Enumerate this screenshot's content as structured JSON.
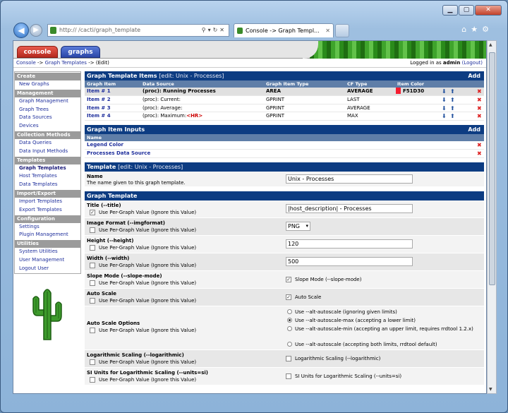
{
  "browser": {
    "url": "http://                    /cacti/graph_template",
    "tab_title": "Console -> Graph Templ...",
    "tab_close": "✕"
  },
  "top_tabs": {
    "console": "console",
    "graphs": "graphs"
  },
  "breadcrumb": {
    "c1": "Console",
    "sep1": "->",
    "c2": "Graph Templates",
    "sep2": "->",
    "c3": "(Edit)"
  },
  "login": {
    "prefix": "Logged in as",
    "user": "admin",
    "logout": "(Logout)"
  },
  "sidebar": {
    "create": "Create",
    "new_graphs": "New Graphs",
    "management": "Management",
    "graph_management": "Graph Management",
    "graph_trees": "Graph Trees",
    "data_sources": "Data Sources",
    "devices": "Devices",
    "collection": "Collection Methods",
    "data_queries": "Data Queries",
    "data_input": "Data Input Methods",
    "templates": "Templates",
    "graph_templates": "Graph Templates",
    "host_templates": "Host Templates",
    "data_templates": "Data Templates",
    "import_export": "Import/Export",
    "import_templates": "Import Templates",
    "export_templates": "Export Templates",
    "configuration": "Configuration",
    "settings": "Settings",
    "plugin_mgmt": "Plugin Management",
    "utilities": "Utilities",
    "system_utilities": "System Utilities",
    "user_management": "User Management",
    "logout_user": "Logout User"
  },
  "items": {
    "title": "Graph Template Items",
    "edit": "[edit: Unix - Processes]",
    "add": "Add",
    "cols": [
      "Graph Item",
      "Data Source",
      "Graph Item Type",
      "CF Type",
      "Item Color"
    ],
    "rows": [
      {
        "item": "Item # 1",
        "ds": "(proc): Running Processes",
        "type": "AREA",
        "cf": "AVERAGE",
        "color": "F51D30"
      },
      {
        "item": "Item # 2",
        "ds": "(proc): Current:",
        "type": "GPRINT",
        "cf": "LAST"
      },
      {
        "item": "Item # 3",
        "ds": "(proc): Average:",
        "type": "GPRINT",
        "cf": "AVERAGE"
      },
      {
        "item": "Item # 4",
        "ds": "(proc): Maximum:",
        "ds_hr": "<HR>",
        "type": "GPRINT",
        "cf": "MAX"
      }
    ]
  },
  "inputs": {
    "title": "Graph Item Inputs",
    "add": "Add",
    "col": "Name",
    "rows": [
      "Legend Color",
      "Processes Data Source"
    ]
  },
  "template": {
    "title": "Template",
    "edit": "[edit: Unix - Processes]",
    "name_label": "Name",
    "name_desc": "The name given to this graph template.",
    "name_value": "Unix - Processes"
  },
  "gt": {
    "title": "Graph Template",
    "per_graph": "Use Per-Graph Value (Ignore this Value)",
    "title_label": "Title (--title)",
    "title_value": "|host_description| - Processes",
    "imgformat_label": "Image Format (--imgformat)",
    "imgformat_value": "PNG",
    "height_label": "Height (--height)",
    "height_value": "120",
    "width_label": "Width (--width)",
    "width_value": "500",
    "slope_label": "Slope Mode (--slope-mode)",
    "slope_value": "Slope Mode (--slope-mode)",
    "autoscale_label": "Auto Scale",
    "autoscale_value": "Auto Scale",
    "aso_label": "Auto Scale Options",
    "aso_opts": [
      "Use --alt-autoscale (ignoring given limits)",
      "Use --alt-autoscale-max (accepting a lower limit)",
      "Use --alt-autoscale-min (accepting an upper limit, requires rrdtool 1.2.x)",
      "Use --alt-autoscale (accepting both limits, rrdtool default)"
    ],
    "log_label": "Logarithmic Scaling (--logarithmic)",
    "log_value": "Logarithmic Scaling (--logarithmic)",
    "si_label": "SI Units for Logarithmic Scaling (--units=si)",
    "si_value": "SI Units for Logarithmic Scaling (--units=si)"
  }
}
